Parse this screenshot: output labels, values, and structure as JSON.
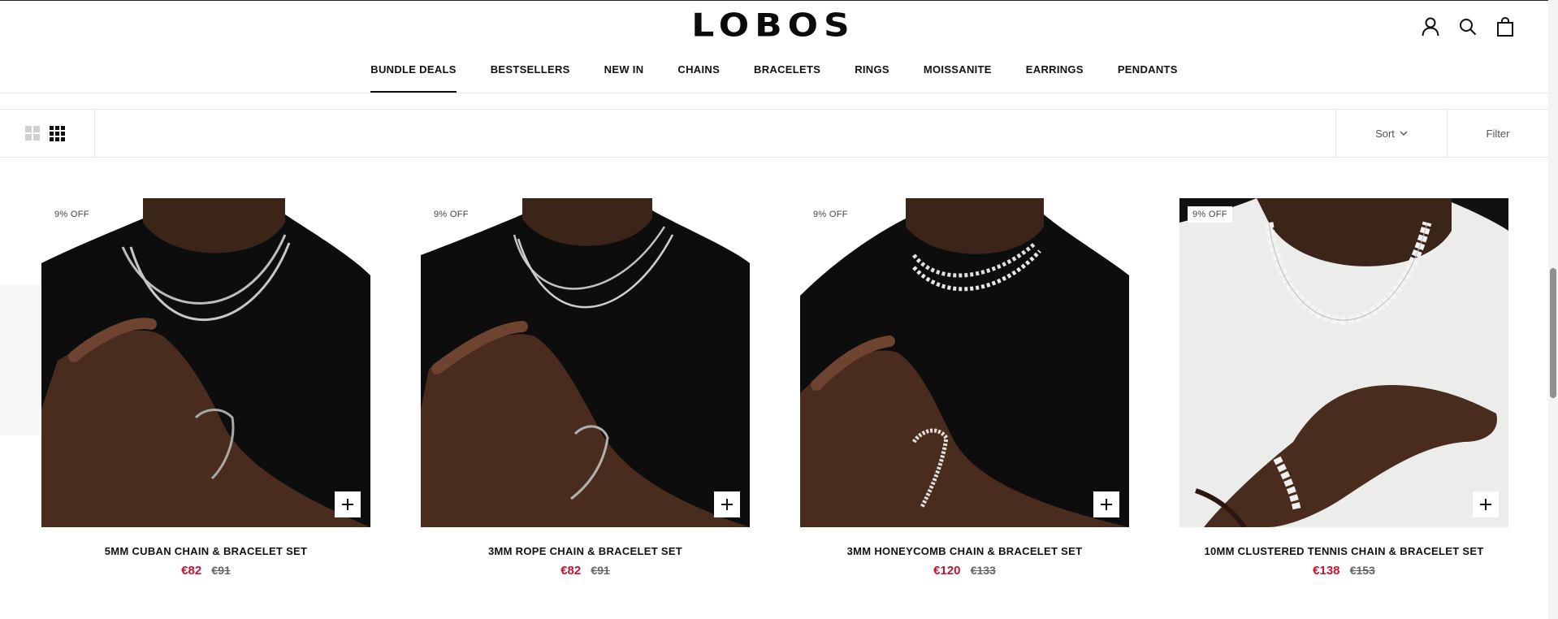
{
  "header": {
    "logo": "LOBOS",
    "icons": [
      "account-icon",
      "search-icon",
      "cart-icon"
    ]
  },
  "nav": {
    "items": [
      {
        "label": "BUNDLE DEALS",
        "active": true
      },
      {
        "label": "BESTSELLERS"
      },
      {
        "label": "NEW IN"
      },
      {
        "label": "CHAINS"
      },
      {
        "label": "BRACELETS"
      },
      {
        "label": "RINGS"
      },
      {
        "label": "MOISSANITE"
      },
      {
        "label": "EARRINGS"
      },
      {
        "label": "PENDANTS"
      }
    ]
  },
  "toolbar": {
    "sort_label": "Sort",
    "filter_label": "Filter"
  },
  "colors": {
    "sale_price": "#c4122f",
    "shirt_black": "#0d0d0d",
    "shirt_white": "#ececea",
    "skin": "#4a2c1f"
  },
  "products": [
    {
      "badge": "9% OFF",
      "title": "5MM CUBAN CHAIN & BRACELET SET",
      "price": "€82",
      "old_price": "€91"
    },
    {
      "badge": "9% OFF",
      "title": "3MM ROPE CHAIN & BRACELET SET",
      "price": "€82",
      "old_price": "€91"
    },
    {
      "badge": "9% OFF",
      "title": "3MM HONEYCOMB CHAIN & BRACELET SET",
      "price": "€120",
      "old_price": "€133"
    },
    {
      "badge": "9% OFF",
      "title": "10MM CLUSTERED TENNIS CHAIN & BRACELET SET",
      "price": "€138",
      "old_price": "€153"
    }
  ]
}
